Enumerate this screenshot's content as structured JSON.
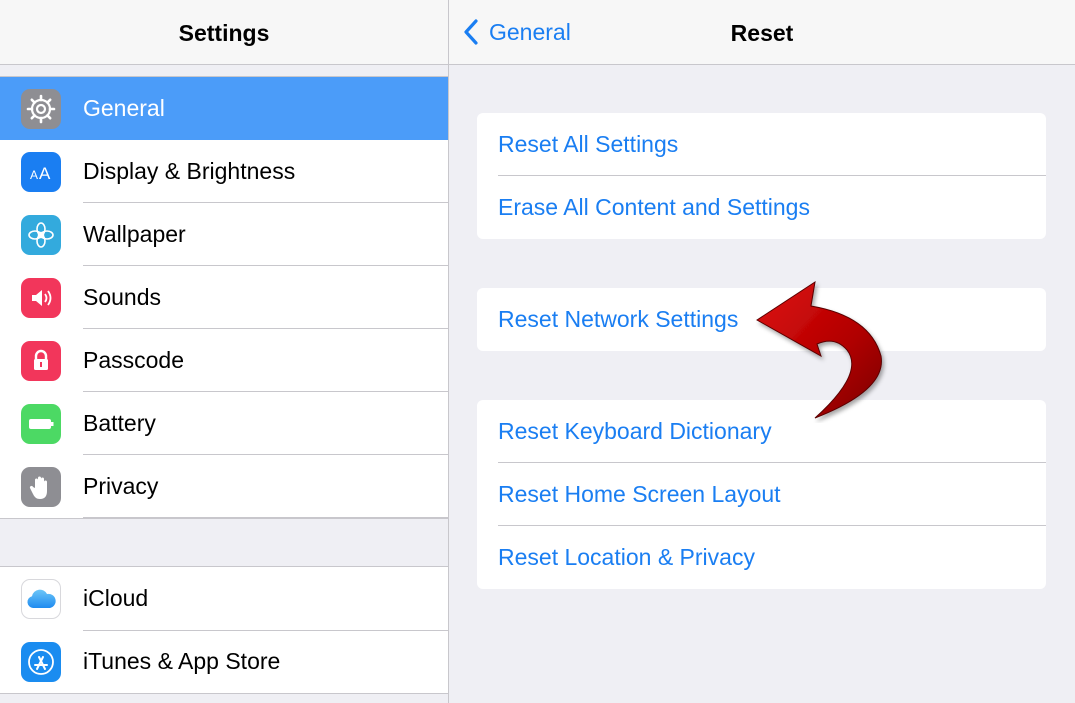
{
  "sidebar": {
    "title": "Settings",
    "group1": [
      {
        "label": "General",
        "icon": "gear-icon",
        "color": "#8e8e93",
        "selected": true
      },
      {
        "label": "Display & Brightness",
        "icon": "text-size-icon",
        "color": "#1a7ef2"
      },
      {
        "label": "Wallpaper",
        "icon": "flower-icon",
        "color": "#33aadd"
      },
      {
        "label": "Sounds",
        "icon": "speaker-icon",
        "color": "#f2365b"
      },
      {
        "label": "Passcode",
        "icon": "lock-icon",
        "color": "#f2365b"
      },
      {
        "label": "Battery",
        "icon": "battery-icon",
        "color": "#4cd964"
      },
      {
        "label": "Privacy",
        "icon": "hand-icon",
        "color": "#8e8e93"
      }
    ],
    "group2": [
      {
        "label": "iCloud",
        "icon": "cloud-icon",
        "color": "#ffffff"
      },
      {
        "label": "iTunes & App Store",
        "icon": "app-store-icon",
        "color": "#1a8cf0"
      }
    ]
  },
  "detail": {
    "back_label": "General",
    "title": "Reset",
    "card1": [
      "Reset All Settings",
      "Erase All Content and Settings"
    ],
    "card2": [
      "Reset Network Settings"
    ],
    "card3": [
      "Reset Keyboard Dictionary",
      "Reset Home Screen Layout",
      "Reset Location & Privacy"
    ]
  },
  "colors": {
    "accent": "#1a7ef2",
    "selection": "#4b9cf9",
    "annotation_arrow": "#cc0000"
  }
}
